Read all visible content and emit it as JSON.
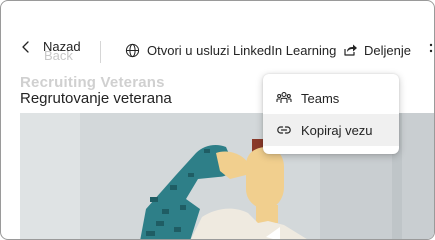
{
  "toolbar": {
    "back_label": "Nazad",
    "back_shadow_label": "Back",
    "open_label": "Otvori u usluzi LinkedIn Learning",
    "share_label": "Deljenje"
  },
  "content": {
    "title": "Regrutovanje veterana",
    "title_ghost": "Recruiting Veterans"
  },
  "share_menu": {
    "items": [
      {
        "label": "Teams",
        "icon": "teams-icon"
      },
      {
        "label": "Kopiraj vezu",
        "icon": "link-icon",
        "highlighted": true
      }
    ]
  },
  "colors": {
    "text": "#242424",
    "menu_highlight": "#f0f0f0",
    "frame_border": "#9a9a9a"
  }
}
